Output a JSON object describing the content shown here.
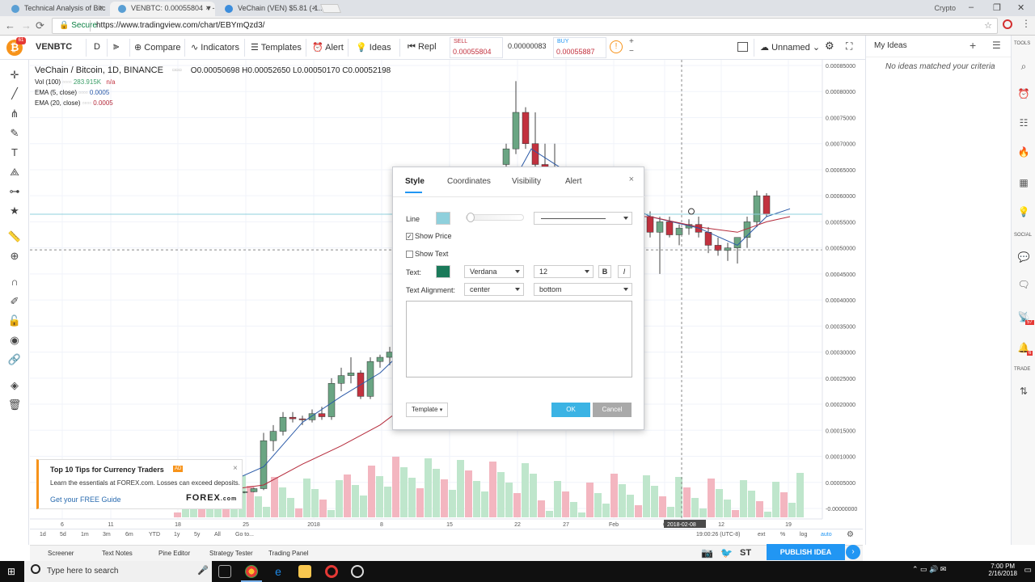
{
  "browser": {
    "tabs": [
      {
        "title": "Technical Analysis of Bitc",
        "active": false
      },
      {
        "title": "VENBTC: 0.00055804 ▼-",
        "active": true
      },
      {
        "title": "VeChain (VEN) $5.81 (-1...",
        "active": false
      }
    ],
    "user": "Crypto",
    "secure_label": "Secure",
    "url": "https://www.tradingview.com/chart/EBYmQzd3/"
  },
  "toolbar": {
    "symbol": "VENBTC",
    "interval": "D",
    "compare": "Compare",
    "indicators": "Indicators",
    "templates": "Templates",
    "alert": "Alert",
    "ideas": "Ideas",
    "replay": "Repl",
    "sell_label": "SELL",
    "sell_price": "0.00055804",
    "spread": "0.00000083",
    "buy_label": "BUY",
    "buy_price": "0.00055887",
    "layout_name": "Unnamed"
  },
  "legend": {
    "title": "VeChain / Bitcoin, 1D, BINANCE",
    "ohlc": "O0.00050698 H0.00052650 L0.00050170 C0.00052198",
    "vol_label": "Vol (100)",
    "vol_value": "283.915K",
    "vol_na": "n/a",
    "ema5_label": "EMA (5, close)",
    "ema5_value": "0.0005",
    "ema20_label": "EMA (20, close)",
    "ema20_value": "0.0005"
  },
  "price_axis": {
    "ticks": [
      "0.00085000",
      "0.00080000",
      "0.00075000",
      "0.00070000",
      "0.00065000",
      "0.00060000",
      "0.00055000",
      "0.00050000",
      "0.00045000",
      "0.00040000",
      "0.00035000",
      "0.00030000",
      "0.00025000",
      "0.00020000",
      "0.00015000",
      "0.00010000",
      "0.00005000",
      "-0.00000000"
    ],
    "last_price": "0.00055804",
    "ema_price": "0.00055212",
    "cursor_price": "0.00049618"
  },
  "time_axis": {
    "ticks": [
      "6",
      "11",
      "18",
      "25",
      "2018",
      "8",
      "15",
      "22",
      "27",
      "Feb",
      "6",
      "12",
      "19"
    ],
    "cursor_date": "2018-02-08"
  },
  "range_bar": {
    "buttons": [
      "1d",
      "5d",
      "1m",
      "3m",
      "6m",
      "YTD",
      "1y",
      "5y",
      "All",
      "Go to..."
    ],
    "time": "19:00:26 (UTC-8)",
    "ext": "ext",
    "pct": "%",
    "log": "log",
    "auto": "auto"
  },
  "panels": {
    "tabs": [
      "Screener",
      "Text Notes",
      "Pine Editor",
      "Strategy Tester",
      "Trading Panel"
    ],
    "publish": "PUBLISH IDEA",
    "st": "ST"
  },
  "ideas_panel": {
    "title": "My Ideas",
    "empty": "No ideas matched your criteria"
  },
  "right_bar": {
    "tools_label": "TOOLS",
    "social_label": "SOCIAL",
    "trade_label": "TRADE",
    "badge1": "57",
    "badge2": "6"
  },
  "dialog": {
    "tabs": [
      "Style",
      "Coordinates",
      "Visibility",
      "Alert"
    ],
    "line_label": "Line",
    "line_color": "#8fd0dc",
    "show_price": "Show Price",
    "show_price_checked": true,
    "show_text": "Show Text",
    "show_text_checked": false,
    "text_label": "Text:",
    "text_color": "#1a7a5a",
    "font": "Verdana",
    "size": "12",
    "bold": "B",
    "italic": "I",
    "align_label": "Text Alignment:",
    "h_align": "center",
    "v_align": "bottom",
    "template": "Template",
    "ok": "OK",
    "cancel": "Cancel"
  },
  "ad": {
    "title": "Top 10 Tips for Currency Traders",
    "badge": "AD",
    "body": "Learn the essentials at FOREX.com. Losses can exceed deposits.",
    "link": "Get your FREE Guide",
    "brand": "FOREX",
    "brand_suffix": ".com"
  },
  "taskbar": {
    "search_placeholder": "Type here to search",
    "time": "7:00 PM",
    "date": "2/16/2018"
  },
  "colors": {
    "up": "#6aa583",
    "down": "#c2323f",
    "up_volume": "#bfe6cc",
    "down_volume": "#f3b6c0",
    "ema_fast": "#2b5aa8",
    "ema_slow": "#b52b3b",
    "accent": "#2196f3"
  }
}
